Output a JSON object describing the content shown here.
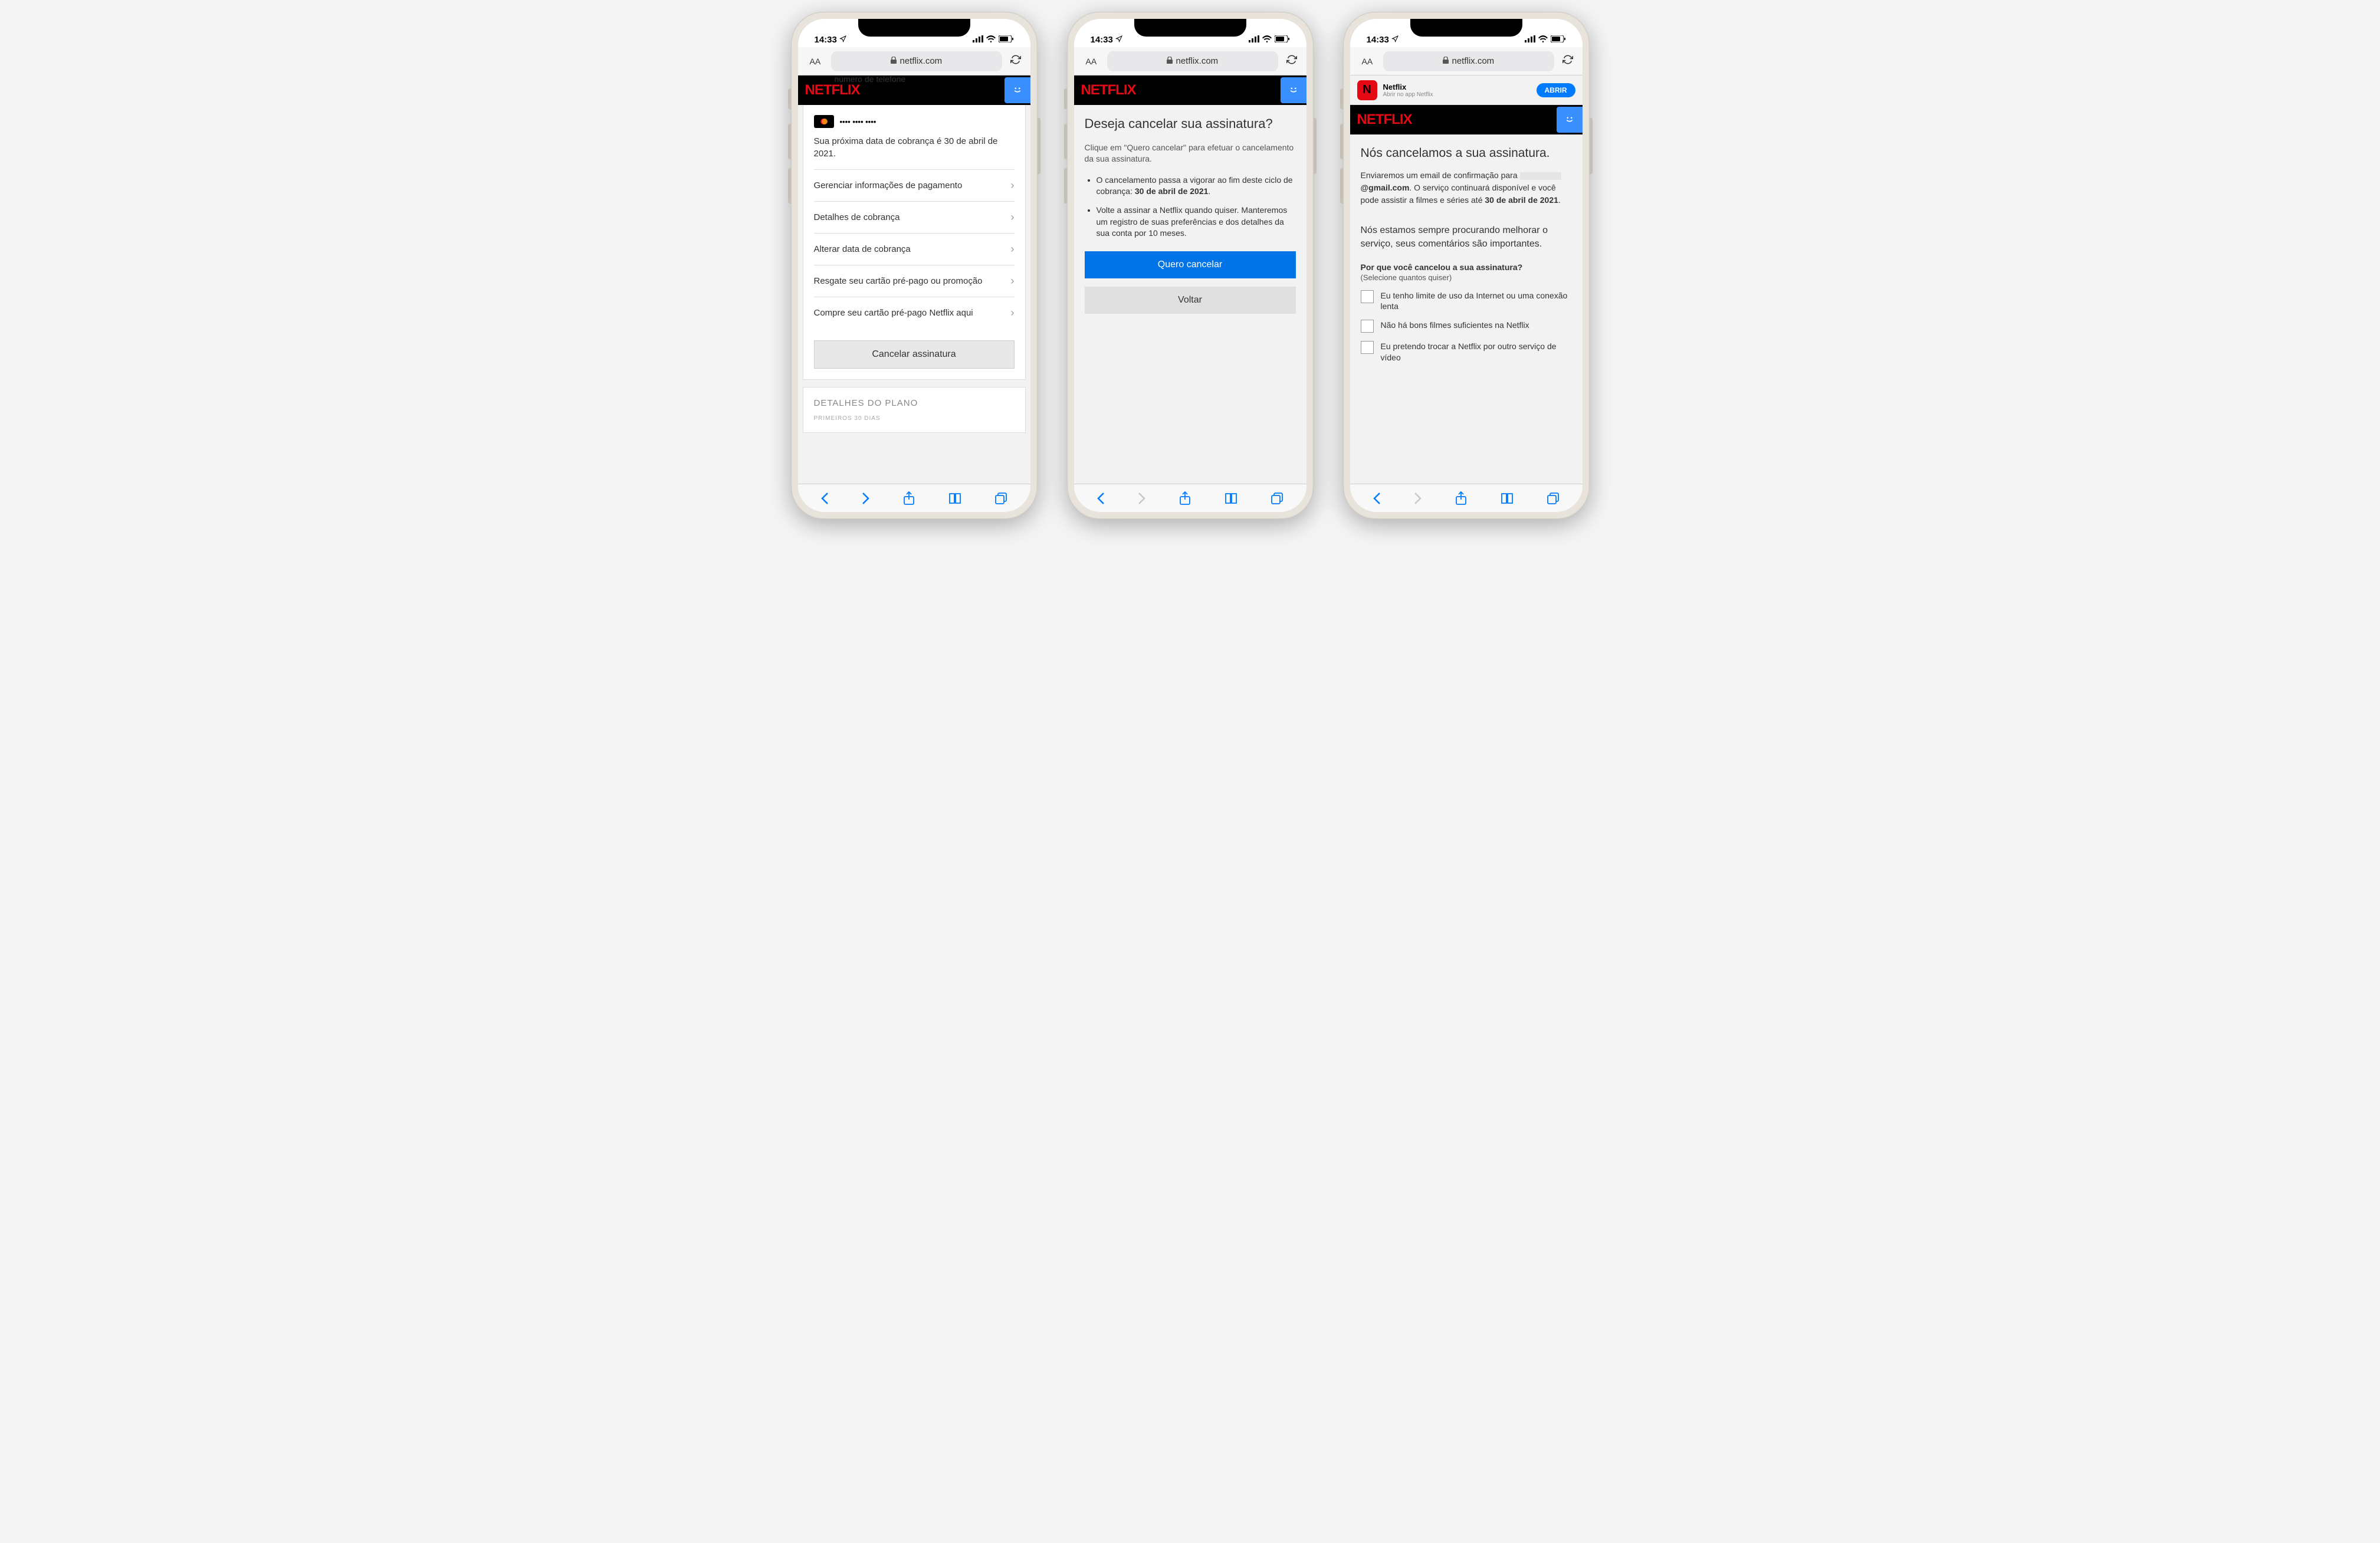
{
  "status": {
    "time": "14:33",
    "location_icon": true
  },
  "safari": {
    "domain": "netflix.com",
    "aa_label": "AA"
  },
  "netflix_logo": "NETFLIX",
  "phone1": {
    "faded_header": "número de telefone",
    "card_masked": "•••• •••• ••••",
    "next_billing": "Sua próxima data de cobrança é 30 de abril de 2021.",
    "menu": [
      "Gerenciar informações de pagamento",
      "Detalhes de cobrança",
      "Alterar data de cobrança",
      "Resgate seu cartão pré-pago ou promoção",
      "Compre seu cartão pré-pago Netflix aqui"
    ],
    "cancel_button": "Cancelar assinatura",
    "plan_title": "DETALHES DO PLANO",
    "plan_sub": "PRIMEIROS 30 DIAS"
  },
  "phone2": {
    "title": "Deseja cancelar sua assinatura?",
    "subtitle": "Clique em \"Quero cancelar\" para efetuar o cancelamento da sua assinatura.",
    "bullet1_prefix": "O cancelamento passa a vigorar ao fim deste ciclo de cobrança: ",
    "bullet1_bold": "30 de abril de 2021",
    "bullet2": "Volte a assinar a Netflix quando quiser. Manteremos um registro de suas preferências e dos detalhes da sua conta por 10 meses.",
    "primary_button": "Quero cancelar",
    "secondary_button": "Voltar"
  },
  "phone3": {
    "app_banner": {
      "name": "Netflix",
      "subtitle": "Abrir no app Netflix",
      "button": "ABRIR"
    },
    "title": "Nós cancelamos a sua assinatura.",
    "text_prefix": "Enviaremos um email de confirmação para ",
    "email_suffix": "@gmail.com",
    "text_middle": ". O serviço continuará disponível e você pode assistir a filmes e séries até ",
    "text_bold": "30 de abril de 2021",
    "survey_title": "Nós estamos sempre procurando melhorar o serviço, seus comentários são importantes.",
    "survey_question": "Por que você cancelou a sua assinatura?",
    "survey_hint": "(Selecione quantos quiser)",
    "options": [
      "Eu tenho limite de uso da Internet ou uma conexão lenta",
      "Não há bons filmes suficientes na Netflix",
      "Eu pretendo trocar a Netflix por outro serviço de vídeo"
    ]
  }
}
